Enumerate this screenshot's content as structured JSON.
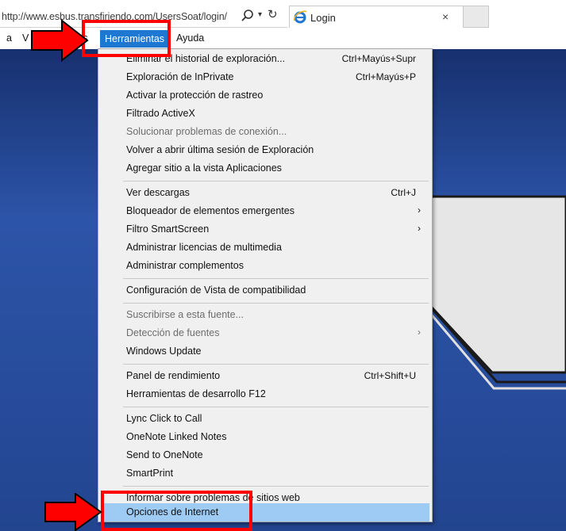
{
  "address_bar": {
    "url": "http://www.esbus.transfiriendo.com/UsersSoat/login/",
    "search_icon": "search-icon",
    "dropdown_icon": "chevron-down-icon",
    "refresh_icon": "refresh-icon"
  },
  "tab": {
    "title": "Login",
    "icon": "ie-logo-icon",
    "close_glyph": "×"
  },
  "menubar": {
    "items": [
      {
        "label": "a"
      },
      {
        "label": "V"
      },
      {
        "label": "tes"
      },
      {
        "label": "Herramientas"
      },
      {
        "label": "Ayuda"
      }
    ]
  },
  "tools_menu": {
    "groups": [
      [
        {
          "label": "Eliminar el historial de exploración...",
          "shortcut": "Ctrl+Mayús+Supr"
        },
        {
          "label": "Exploración de InPrivate",
          "shortcut": "Ctrl+Mayús+P"
        },
        {
          "label": "Activar la protección de rastreo"
        },
        {
          "label": "Filtrado ActiveX"
        },
        {
          "label": "Solucionar problemas de conexión...",
          "disabled": true
        },
        {
          "label": "Volver a abrir última sesión de Exploración"
        },
        {
          "label": "Agregar sitio a la vista Aplicaciones"
        }
      ],
      [
        {
          "label": "Ver descargas",
          "shortcut": "Ctrl+J"
        },
        {
          "label": "Bloqueador de elementos emergentes",
          "arrow": "›"
        },
        {
          "label": "Filtro SmartScreen",
          "arrow": "›"
        },
        {
          "label": "Administrar licencias de multimedia"
        },
        {
          "label": "Administrar complementos"
        }
      ],
      [
        {
          "label": "Configuración de Vista de compatibilidad"
        }
      ],
      [
        {
          "label": "Suscribirse a esta fuente...",
          "disabled": true
        },
        {
          "label": "Detección de fuentes",
          "arrow": "›",
          "disabled": true
        },
        {
          "label": "Windows Update"
        }
      ],
      [
        {
          "label": "Panel de rendimiento",
          "shortcut": "Ctrl+Shift+U"
        },
        {
          "label": "Herramientas de desarrollo F12"
        }
      ],
      [
        {
          "label": "Lync Click to Call"
        },
        {
          "label": "OneNote Linked Notes"
        },
        {
          "label": "Send to OneNote"
        },
        {
          "label": "SmartPrint"
        }
      ],
      [
        {
          "label": "Informar sobre problemas de sitios web"
        },
        {
          "label": "Opciones de Internet",
          "selected": true
        }
      ]
    ]
  },
  "annotations": {
    "color": "#ff0000",
    "highlighted": [
      "Herramientas",
      "Opciones de Internet"
    ]
  },
  "colors": {
    "menubar_active": "#1e78d2",
    "menu_selected": "#9ecbf4",
    "page_background": "#27499a"
  }
}
